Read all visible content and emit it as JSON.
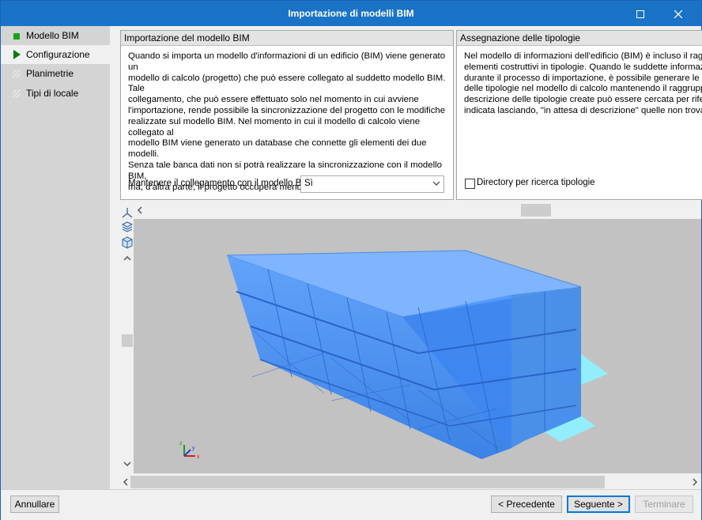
{
  "window": {
    "title": "Importazione di modelli BIM"
  },
  "sidebar": {
    "items": [
      {
        "label": "Modello BIM",
        "state": "done"
      },
      {
        "label": "Configurazione",
        "state": "current"
      },
      {
        "label": "Planimetrie",
        "state": "pending"
      },
      {
        "label": "Tipi di locale",
        "state": "pending"
      }
    ]
  },
  "import_group": {
    "header": "Importazione del modello BIM",
    "text": "Quando si importa un modello d'informazioni di un edificio (BIM) viene generato un\nmodello di calcolo (progetto) che può essere collegato al suddetto modello BIM. Tale\ncollegamento, che può essere effettuato solo nel momento in cui avviene\nl'importazione, rende possibile la sincronizzazione del progetto con le modifiche\nrealizzate sul modello BIM. Nel momento in cui il modello di calcolo viene collegato al\nmodello BIM viene generato un database che connette gli elementi dei due modelli.\nSenza tale banca dati non si potrà realizzare la sincronizzazione con il modello BIM,\nma, d'altra parte, il progetto occuperà meno memoria e spazio sull'hard disk.",
    "keep_link_label": "Mantenere il collegamento con il modello BIM",
    "keep_link_value": "Sì"
  },
  "typology_group": {
    "header": "Assegnazione delle tipologie",
    "text": "Nel modello di informazioni dell'edificio (BIM) è incluso il raggrup\nelementi costruttivi in tipologie. Quando le suddette informazioni\ndurante il processo di importazione, è possibile generare le com\ndelle tipologie nel modello di calcolo mantenendo il raggruppame\ndescrizione delle tipologie create può essere cercata per riferime\nindicata lasciando, \"in attesa di descrizione\" quelle non trovate",
    "directory_checkbox_label": "Directory per ricerca tipologie",
    "directory_checked": false
  },
  "axes": {
    "x": "x",
    "y": "y",
    "z": "z"
  },
  "footer": {
    "cancel": "Annullare",
    "previous": "< Precedente",
    "next": "Seguente >",
    "finish": "Terminare"
  },
  "colors": {
    "titlebar": "#1a73c7",
    "building": "#3b8cf0",
    "slab": "#8ff0ff",
    "done_marker": "#1aa31a",
    "current_marker": "#0b7a0b"
  }
}
